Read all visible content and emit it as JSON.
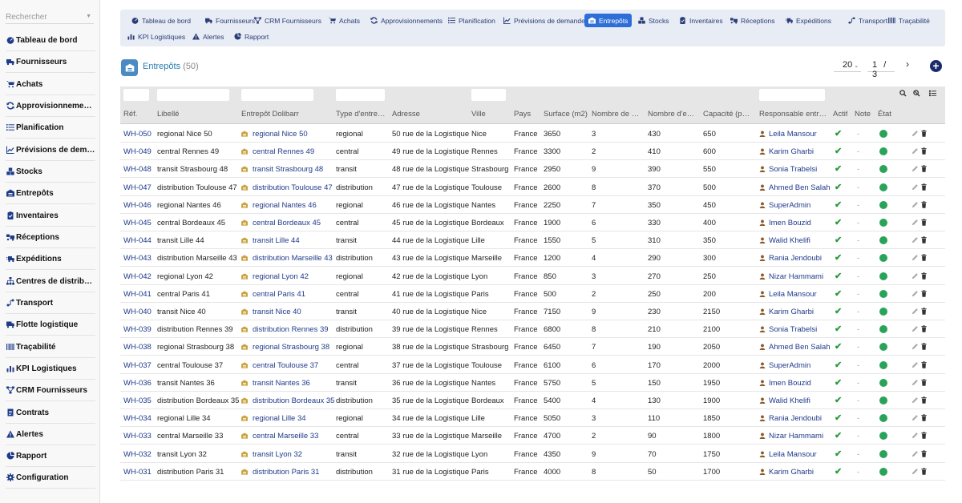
{
  "sidebar": {
    "search_placeholder": "Rechercher",
    "items": [
      {
        "label": "Tableau de bord",
        "icon": "dashboard-icon"
      },
      {
        "label": "Fournisseurs",
        "icon": "truck-icon"
      },
      {
        "label": "Achats",
        "icon": "cart-icon"
      },
      {
        "label": "Approvisionnements",
        "icon": "sync-icon"
      },
      {
        "label": "Planification",
        "icon": "list-icon"
      },
      {
        "label": "Prévisions de demande",
        "icon": "chart-line-icon"
      },
      {
        "label": "Stocks",
        "icon": "cubes-icon"
      },
      {
        "label": "Entrepôts",
        "icon": "warehouse-icon"
      },
      {
        "label": "Inventaires",
        "icon": "clipboard-check-icon"
      },
      {
        "label": "Réceptions",
        "icon": "truck-loading-icon"
      },
      {
        "label": "Expéditions",
        "icon": "shipping-fast-icon"
      },
      {
        "label": "Centres de distribution",
        "icon": "sitemap-icon"
      },
      {
        "label": "Transport",
        "icon": "route-icon"
      },
      {
        "label": "Flotte logistique",
        "icon": "truck-moving-icon"
      },
      {
        "label": "Traçabilité",
        "icon": "barcode-icon"
      },
      {
        "label": "KPI Logistiques",
        "icon": "chart-bar-icon"
      },
      {
        "label": "CRM Fournisseurs",
        "icon": "network-icon"
      },
      {
        "label": "Contrats",
        "icon": "contract-icon"
      },
      {
        "label": "Alertes",
        "icon": "warning-icon"
      },
      {
        "label": "Rapport",
        "icon": "report-icon"
      },
      {
        "label": "Configuration",
        "icon": "gear-icon"
      }
    ]
  },
  "topmenu": {
    "items": [
      {
        "label": "Tableau de bord",
        "icon": "dashboard-icon"
      },
      {
        "label": "Fournisseurs",
        "icon": "truck-icon"
      },
      {
        "label": "CRM Fournisseurs",
        "icon": "network-icon"
      },
      {
        "label": "Achats",
        "icon": "cart-icon"
      },
      {
        "label": "Approvisionnements",
        "icon": "sync-icon"
      },
      {
        "label": "Planification",
        "icon": "list-icon"
      },
      {
        "label": "Prévisions de demande",
        "icon": "chart-line-icon"
      },
      {
        "label": "Entrepôts",
        "icon": "warehouse-icon",
        "active": true
      },
      {
        "label": "Stocks",
        "icon": "cubes-icon"
      },
      {
        "label": "Inventaires",
        "icon": "clipboard-check-icon"
      },
      {
        "label": "Réceptions",
        "icon": "truck-loading-icon"
      },
      {
        "label": "Expéditions",
        "icon": "shipping-fast-icon"
      },
      {
        "label": "Transport",
        "icon": "route-icon"
      },
      {
        "label": "Traçabilité",
        "icon": "barcode-icon"
      },
      {
        "label": "KPI Logistiques",
        "icon": "chart-bar-icon"
      },
      {
        "label": "Alertes",
        "icon": "warning-icon"
      },
      {
        "label": "Rapport",
        "icon": "report-icon"
      }
    ]
  },
  "page": {
    "title": "Entrepôts",
    "count": "(50)",
    "page_size": "20",
    "current_page": "1",
    "page_sep": "/",
    "total_pages": "3"
  },
  "colors": {
    "accent": "#2e6ed8",
    "link": "#1f3b8a",
    "status_ok": "#2aa35a"
  },
  "table": {
    "headers": [
      "Réf.",
      "Libellé",
      "Entrepôt Dolibarr",
      "Type d'entre…",
      "Adresse",
      "Ville",
      "Pays",
      "Surface (m2)",
      "Nombre de z…",
      "Nombre d'e…",
      "Capacité (pa…",
      "Responsable entre…",
      "Actif",
      "Note",
      "État"
    ],
    "rows": [
      [
        "WH-050",
        "regional Nice 50",
        "regional Nice 50",
        "regional",
        "50 rue de la Logistique",
        "Nice",
        "France",
        "3650",
        "3",
        "430",
        "650",
        "Leila Mansour",
        "✔",
        "-"
      ],
      [
        "WH-049",
        "central Rennes 49",
        "central Rennes 49",
        "central",
        "49 rue de la Logistique",
        "Rennes",
        "France",
        "3300",
        "2",
        "410",
        "600",
        "Karim Gharbi",
        "✔",
        "-"
      ],
      [
        "WH-048",
        "transit Strasbourg 48",
        "transit Strasbourg 48",
        "transit",
        "48 rue de la Logistique",
        "Strasbourg",
        "France",
        "2950",
        "9",
        "390",
        "550",
        "Sonia Trabelsi",
        "✔",
        "-"
      ],
      [
        "WH-047",
        "distribution Toulouse 47",
        "distribution Toulouse 47",
        "distribution",
        "47 rue de la Logistique",
        "Toulouse",
        "France",
        "2600",
        "8",
        "370",
        "500",
        "Ahmed Ben Salah",
        "✔",
        "-"
      ],
      [
        "WH-046",
        "regional Nantes 46",
        "regional Nantes 46",
        "regional",
        "46 rue de la Logistique",
        "Nantes",
        "France",
        "2250",
        "7",
        "350",
        "450",
        "SuperAdmin",
        "✔",
        "-"
      ],
      [
        "WH-045",
        "central Bordeaux 45",
        "central Bordeaux 45",
        "central",
        "45 rue de la Logistique",
        "Bordeaux",
        "France",
        "1900",
        "6",
        "330",
        "400",
        "Imen Bouzid",
        "✔",
        "-"
      ],
      [
        "WH-044",
        "transit Lille 44",
        "transit Lille 44",
        "transit",
        "44 rue de la Logistique",
        "Lille",
        "France",
        "1550",
        "5",
        "310",
        "350",
        "Walid Khelifi",
        "✔",
        "-"
      ],
      [
        "WH-043",
        "distribution Marseille 43",
        "distribution Marseille 43",
        "distribution",
        "43 rue de la Logistique",
        "Marseille",
        "France",
        "1200",
        "4",
        "290",
        "300",
        "Rania Jendoubi",
        "✔",
        "-"
      ],
      [
        "WH-042",
        "regional Lyon 42",
        "regional Lyon 42",
        "regional",
        "42 rue de la Logistique",
        "Lyon",
        "France",
        "850",
        "3",
        "270",
        "250",
        "Nizar Hammami",
        "✔",
        "-"
      ],
      [
        "WH-041",
        "central Paris 41",
        "central Paris 41",
        "central",
        "41 rue de la Logistique",
        "Paris",
        "France",
        "500",
        "2",
        "250",
        "200",
        "Leila Mansour",
        "✔",
        "-"
      ],
      [
        "WH-040",
        "transit Nice 40",
        "transit Nice 40",
        "transit",
        "40 rue de la Logistique",
        "Nice",
        "France",
        "7150",
        "9",
        "230",
        "2150",
        "Karim Gharbi",
        "✔",
        "-"
      ],
      [
        "WH-039",
        "distribution Rennes 39",
        "distribution Rennes 39",
        "distribution",
        "39 rue de la Logistique",
        "Rennes",
        "France",
        "6800",
        "8",
        "210",
        "2100",
        "Sonia Trabelsi",
        "✔",
        "-"
      ],
      [
        "WH-038",
        "regional Strasbourg 38",
        "regional Strasbourg 38",
        "regional",
        "38 rue de la Logistique",
        "Strasbourg",
        "France",
        "6450",
        "7",
        "190",
        "2050",
        "Ahmed Ben Salah",
        "✔",
        "-"
      ],
      [
        "WH-037",
        "central Toulouse 37",
        "central Toulouse 37",
        "central",
        "37 rue de la Logistique",
        "Toulouse",
        "France",
        "6100",
        "6",
        "170",
        "2000",
        "SuperAdmin",
        "✔",
        "-"
      ],
      [
        "WH-036",
        "transit Nantes 36",
        "transit Nantes 36",
        "transit",
        "36 rue de la Logistique",
        "Nantes",
        "France",
        "5750",
        "5",
        "150",
        "1950",
        "Imen Bouzid",
        "✔",
        "-"
      ],
      [
        "WH-035",
        "distribution Bordeaux 35",
        "distribution Bordeaux 35",
        "distribution",
        "35 rue de la Logistique",
        "Bordeaux",
        "France",
        "5400",
        "4",
        "130",
        "1900",
        "Walid Khelifi",
        "✔",
        "-"
      ],
      [
        "WH-034",
        "regional Lille 34",
        "regional Lille 34",
        "regional",
        "34 rue de la Logistique",
        "Lille",
        "France",
        "5050",
        "3",
        "110",
        "1850",
        "Rania Jendoubi",
        "✔",
        "-"
      ],
      [
        "WH-033",
        "central Marseille 33",
        "central Marseille 33",
        "central",
        "33 rue de la Logistique",
        "Marseille",
        "France",
        "4700",
        "2",
        "90",
        "1800",
        "Nizar Hammami",
        "✔",
        "-"
      ],
      [
        "WH-032",
        "transit Lyon 32",
        "transit Lyon 32",
        "transit",
        "32 rue de la Logistique",
        "Lyon",
        "France",
        "4350",
        "9",
        "70",
        "1750",
        "Leila Mansour",
        "✔",
        "-"
      ],
      [
        "WH-031",
        "distribution Paris 31",
        "distribution Paris 31",
        "distribution",
        "31 rue de la Logistique",
        "Paris",
        "France",
        "4000",
        "8",
        "50",
        "1700",
        "Karim Gharbi",
        "✔",
        "-"
      ]
    ]
  }
}
